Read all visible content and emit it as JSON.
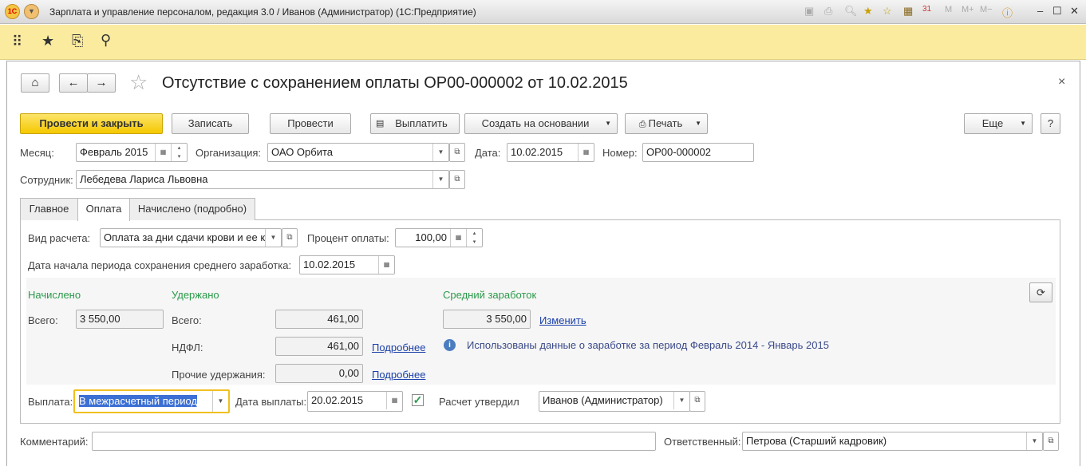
{
  "window": {
    "title": "Зарплата и управление персоналом, редакция 3.0 / Иванов (Администратор)  (1С:Предприятие)",
    "logo": "1С"
  },
  "form": {
    "title": "Отсутствие с сохранением оплаты ОР00-000002 от 10.02.2015",
    "close": "×"
  },
  "toolbar": {
    "post_close": "Провести и закрыть",
    "save": "Записать",
    "post": "Провести",
    "pay": "Выплатить",
    "create_based": "Создать на основании",
    "print": "Печать",
    "more": "Еще",
    "help": "?"
  },
  "header": {
    "month_label": "Месяц:",
    "month": "Февраль 2015",
    "org_label": "Организация:",
    "org": "ОАО Орбита",
    "date_label": "Дата:",
    "date": "10.02.2015",
    "number_label": "Номер:",
    "number": "ОР00-000002",
    "employee_label": "Сотрудник:",
    "employee": "Лебедева Лариса Львовна"
  },
  "tabs": [
    "Главное",
    "Оплата",
    "Начислено (подробно)"
  ],
  "payment": {
    "calc_type_label": "Вид расчета:",
    "calc_type": "Оплата за дни сдачи крови и ее к",
    "percent_label": "Процент оплаты:",
    "percent": "100,00",
    "period_start_label": "Дата начала периода сохранения среднего заработка:",
    "period_start": "10.02.2015"
  },
  "accrued": {
    "title": "Начислено",
    "total_label": "Всего:",
    "total": "3 550,00"
  },
  "withheld": {
    "title": "Удержано",
    "total_label": "Всего:",
    "total": "461,00",
    "ndfl_label": "НДФЛ:",
    "ndfl": "461,00",
    "other_label": "Прочие удержания:",
    "other": "0,00",
    "details": "Подробнее"
  },
  "average": {
    "title": "Средний заработок",
    "value": "3 550,00",
    "change": "Изменить",
    "info": "Использованы данные о заработке за период Февраль 2014 - Январь 2015"
  },
  "payout": {
    "label": "Выплата:",
    "value": "В межрасчетный период",
    "date_label": "Дата выплаты:",
    "date": "20.02.2015",
    "approved_label": "Расчет утвердил",
    "approved_by": "Иванов (Администратор)"
  },
  "footer": {
    "comment_label": "Комментарий:",
    "comment": "",
    "responsible_label": "Ответственный:",
    "responsible": "Петрова (Старший кадровик)"
  }
}
